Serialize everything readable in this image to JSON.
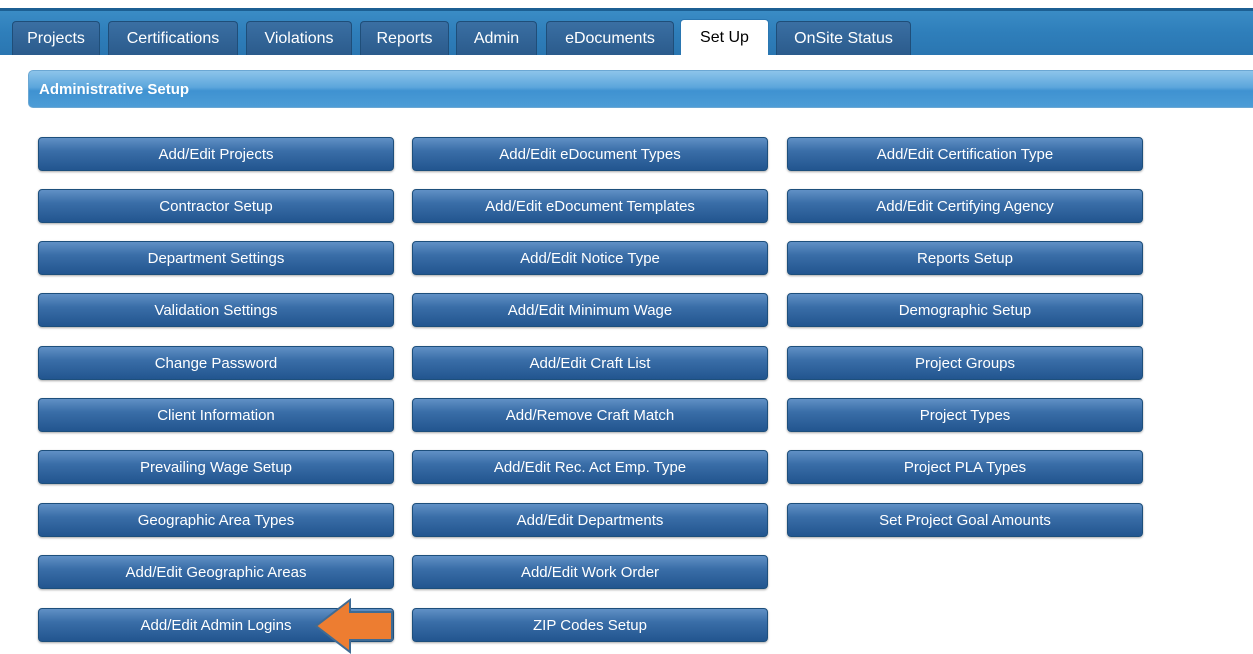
{
  "tabs": [
    {
      "label": "Projects"
    },
    {
      "label": "Certifications"
    },
    {
      "label": "Violations"
    },
    {
      "label": "Reports"
    },
    {
      "label": "Admin"
    },
    {
      "label": "eDocuments"
    },
    {
      "label": "Set Up",
      "active": true
    },
    {
      "label": "OnSite Status"
    }
  ],
  "section": {
    "title": "Administrative Setup"
  },
  "buttons": {
    "col1": [
      "Add/Edit Projects",
      "Contractor Setup",
      "Department Settings",
      "Validation Settings",
      "Change Password",
      "Client Information",
      "Prevailing Wage Setup",
      "Geographic Area Types",
      "Add/Edit Geographic Areas",
      "Add/Edit Admin Logins"
    ],
    "col2": [
      "Add/Edit eDocument Types",
      "Add/Edit eDocument Templates",
      "Add/Edit Notice Type",
      "Add/Edit Minimum Wage",
      "Add/Edit Craft List",
      "Add/Remove Craft Match",
      "Add/Edit Rec. Act Emp. Type",
      "Add/Edit Departments",
      "Add/Edit Work Order",
      "ZIP Codes Setup"
    ],
    "col3": [
      "Add/Edit Certification Type",
      "Add/Edit Certifying Agency",
      "Reports Setup",
      "Demographic Setup",
      "Project Groups",
      "Project Types",
      "Project PLA Types",
      "Set Project Goal Amounts"
    ]
  },
  "annotation": {
    "icon": "arrow-left-icon",
    "color": "#ed7d31"
  }
}
